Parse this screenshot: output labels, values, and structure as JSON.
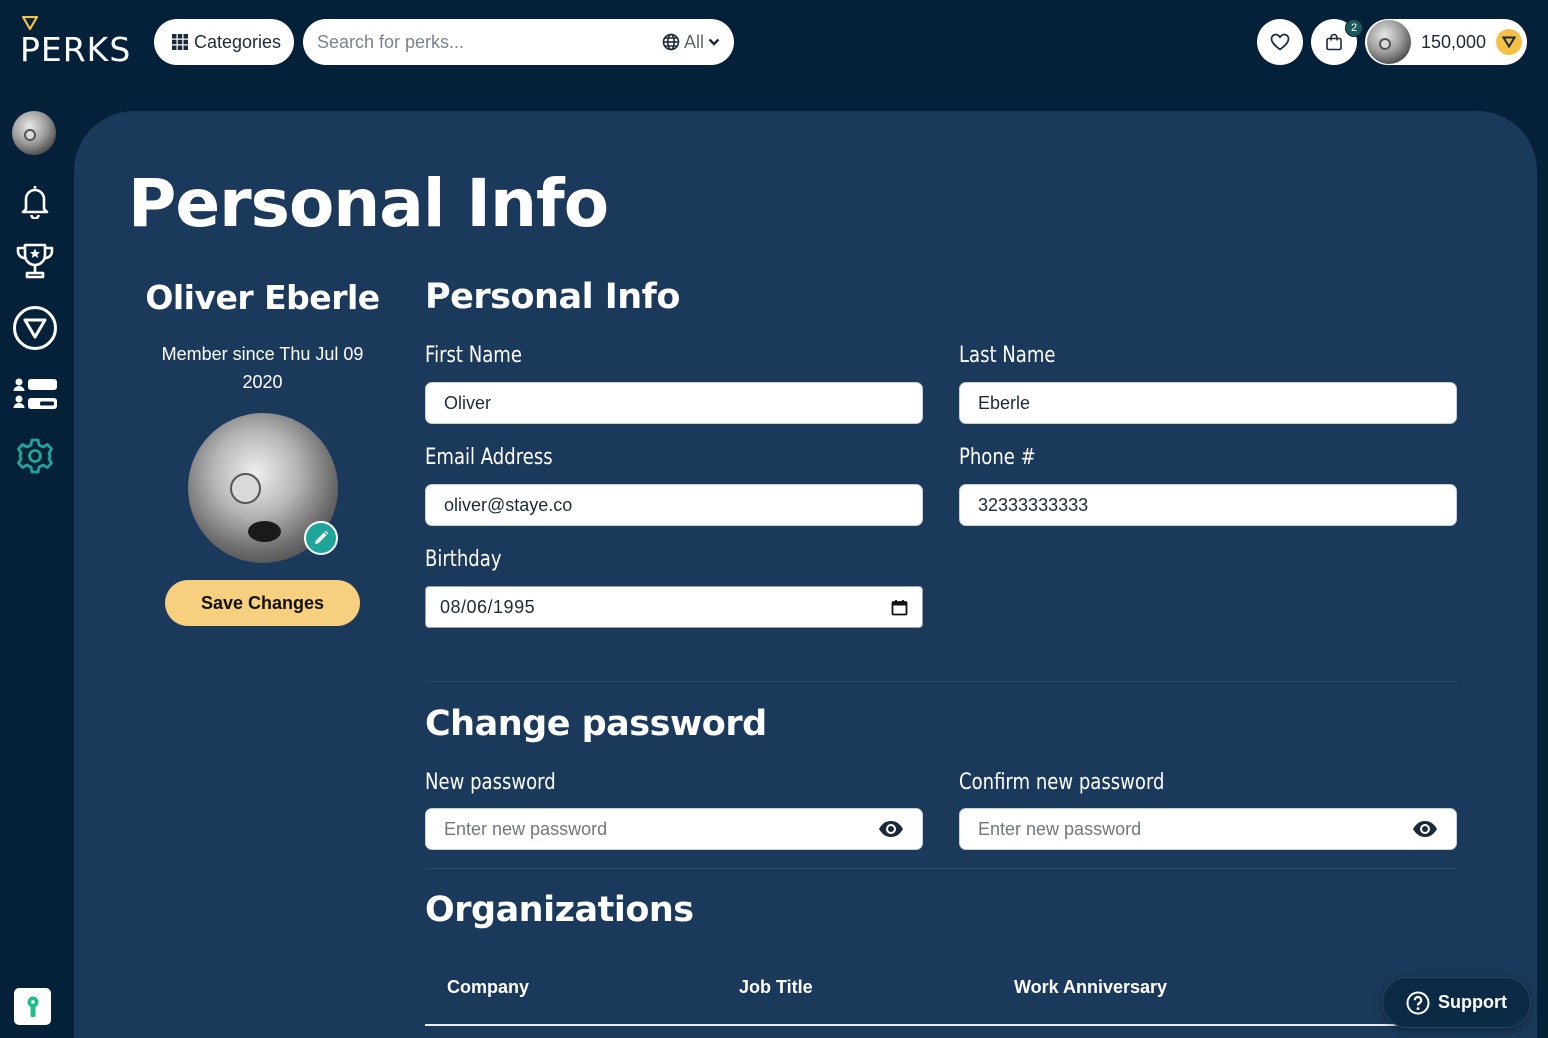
{
  "brand": {
    "name": "PERKS"
  },
  "header": {
    "categories_label": "Categories",
    "search_placeholder": "Search for perks...",
    "search_scope": "All",
    "cart_count": "2",
    "points_balance": "150,000"
  },
  "sidebar": {
    "items": [
      "avatar",
      "bell-icon",
      "trophy-icon",
      "perks-token-icon",
      "id-cards-icon",
      "gear-icon"
    ],
    "active": "gear-icon"
  },
  "page": {
    "title": "Personal Info"
  },
  "profile": {
    "name": "Oliver Eberle",
    "member_since": "Member since Thu Jul 09 2020",
    "save_label": "Save Changes"
  },
  "personal_info": {
    "heading": "Personal Info",
    "first_name_label": "First Name",
    "first_name": "Oliver",
    "last_name_label": "Last Name",
    "last_name": "Eberle",
    "email_label": "Email Address",
    "email": "oliver@staye.co",
    "phone_label": "Phone #",
    "phone": "32333333333",
    "birthday_label": "Birthday",
    "birthday": "08/06/1995"
  },
  "password": {
    "heading": "Change password",
    "new_label": "New password",
    "new_placeholder": "Enter new password",
    "confirm_label": "Confirm new password",
    "confirm_placeholder": "Enter new password"
  },
  "organizations": {
    "heading": "Organizations",
    "columns": [
      "Company",
      "Job Title",
      "Work Anniversary"
    ]
  },
  "support": {
    "label": "Support"
  },
  "colors": {
    "background": "#052139",
    "panel": "#1b3a5b",
    "accent_teal": "#1fa59a",
    "save_button": "#f6cf7f",
    "coin": "#f4c048"
  }
}
